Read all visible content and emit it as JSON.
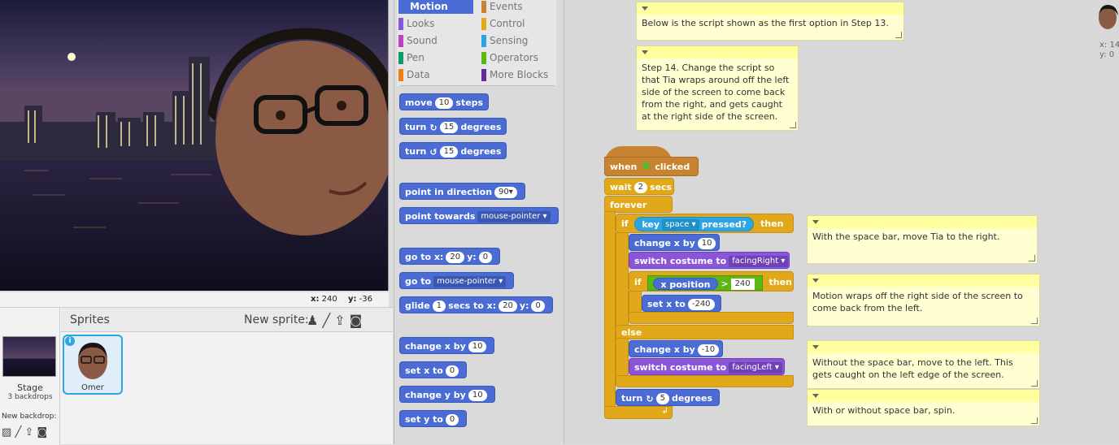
{
  "stage": {
    "coords_x_label": "x:",
    "coords_x": "240",
    "coords_y_label": "y:",
    "coords_y": "-36"
  },
  "sprites": {
    "header": "Sprites",
    "new_sprite_label": "New sprite:",
    "stage_label": "Stage",
    "stage_backdrops": "3 backdrops",
    "new_backdrop_label": "New backdrop:",
    "sprite_name": "Omer",
    "info_glyph": "i"
  },
  "categories": {
    "left": [
      "Motion",
      "Looks",
      "Sound",
      "Pen",
      "Data"
    ],
    "right": [
      "Events",
      "Control",
      "Sensing",
      "Operators",
      "More Blocks"
    ],
    "left_colors": [
      "#4a6cd4",
      "#8a55d7",
      "#bb42c3",
      "#0e9a6c",
      "#ee7d16"
    ],
    "right_colors": [
      "#c88330",
      "#e1a91a",
      "#2ca5e2",
      "#5cb712",
      "#632d99"
    ],
    "selected": "Motion"
  },
  "palette": {
    "move": {
      "a": "move",
      "v": "10",
      "b": "steps"
    },
    "turn_cw": {
      "a": "turn",
      "v": "15",
      "b": "degrees"
    },
    "turn_ccw": {
      "a": "turn",
      "v": "15",
      "b": "degrees"
    },
    "point_dir": {
      "a": "point in direction",
      "v": "90"
    },
    "point_towards": {
      "a": "point towards",
      "v": "mouse-pointer"
    },
    "goto_xy": {
      "a": "go to x:",
      "x": "20",
      "b": "y:",
      "y": "0"
    },
    "goto": {
      "a": "go to",
      "v": "mouse-pointer"
    },
    "glide": {
      "a": "glide",
      "s": "1",
      "b": "secs to x:",
      "x": "20",
      "c": "y:",
      "y": "0"
    },
    "change_x": {
      "a": "change x by",
      "v": "10"
    },
    "set_x": {
      "a": "set x to",
      "v": "0"
    },
    "change_y": {
      "a": "change y by",
      "v": "10"
    },
    "set_y": {
      "a": "set y to",
      "v": "0"
    }
  },
  "script": {
    "when": "when",
    "clicked": "clicked",
    "wait": "wait",
    "wait_v": "2",
    "secs": "secs",
    "forever": "forever",
    "if1": "if",
    "key": "key",
    "key_v": "space",
    "pressed": "pressed?",
    "then1": "then",
    "chx1": "change x by",
    "chx1_v": "10",
    "switch1": "switch costume to",
    "costume1": "facingRight",
    "if2": "if",
    "xpos": "x position",
    "gt": ">",
    "gt_v": "240",
    "then2": "then",
    "setx": "set x to",
    "setx_v": "-240",
    "else": "else",
    "chx2": "change x by",
    "chx2_v": "-10",
    "switch2": "switch costume to",
    "costume2": "facingLeft",
    "turn": "turn",
    "turn_v": "5",
    "degrees": "degrees"
  },
  "notes": {
    "n1": "Below is the script shown as the first option in Step 13.",
    "n2": "Step 14. Change the script so that Tia wraps around off the left side of the screen to come back from the right, and gets caught at the right side of the screen.",
    "n3": "With the space bar, move Tia to the right.",
    "n4": "Motion wraps off the right side of the screen to come back from the left.",
    "n5": "Without the space bar, move to the left. This gets caught on the left edge of the screen.",
    "n6": "With or without space bar, spin."
  },
  "corner": {
    "x_label": "x: 14",
    "y_label": "y: 0"
  },
  "icons": [
    "green-flag-icon",
    "turn-cw-icon",
    "turn-ccw-icon",
    "paint-brush-icon",
    "upload-icon",
    "camera-icon",
    "sprite-library-icon",
    "info-icon",
    "dropdown-arrow-icon"
  ]
}
